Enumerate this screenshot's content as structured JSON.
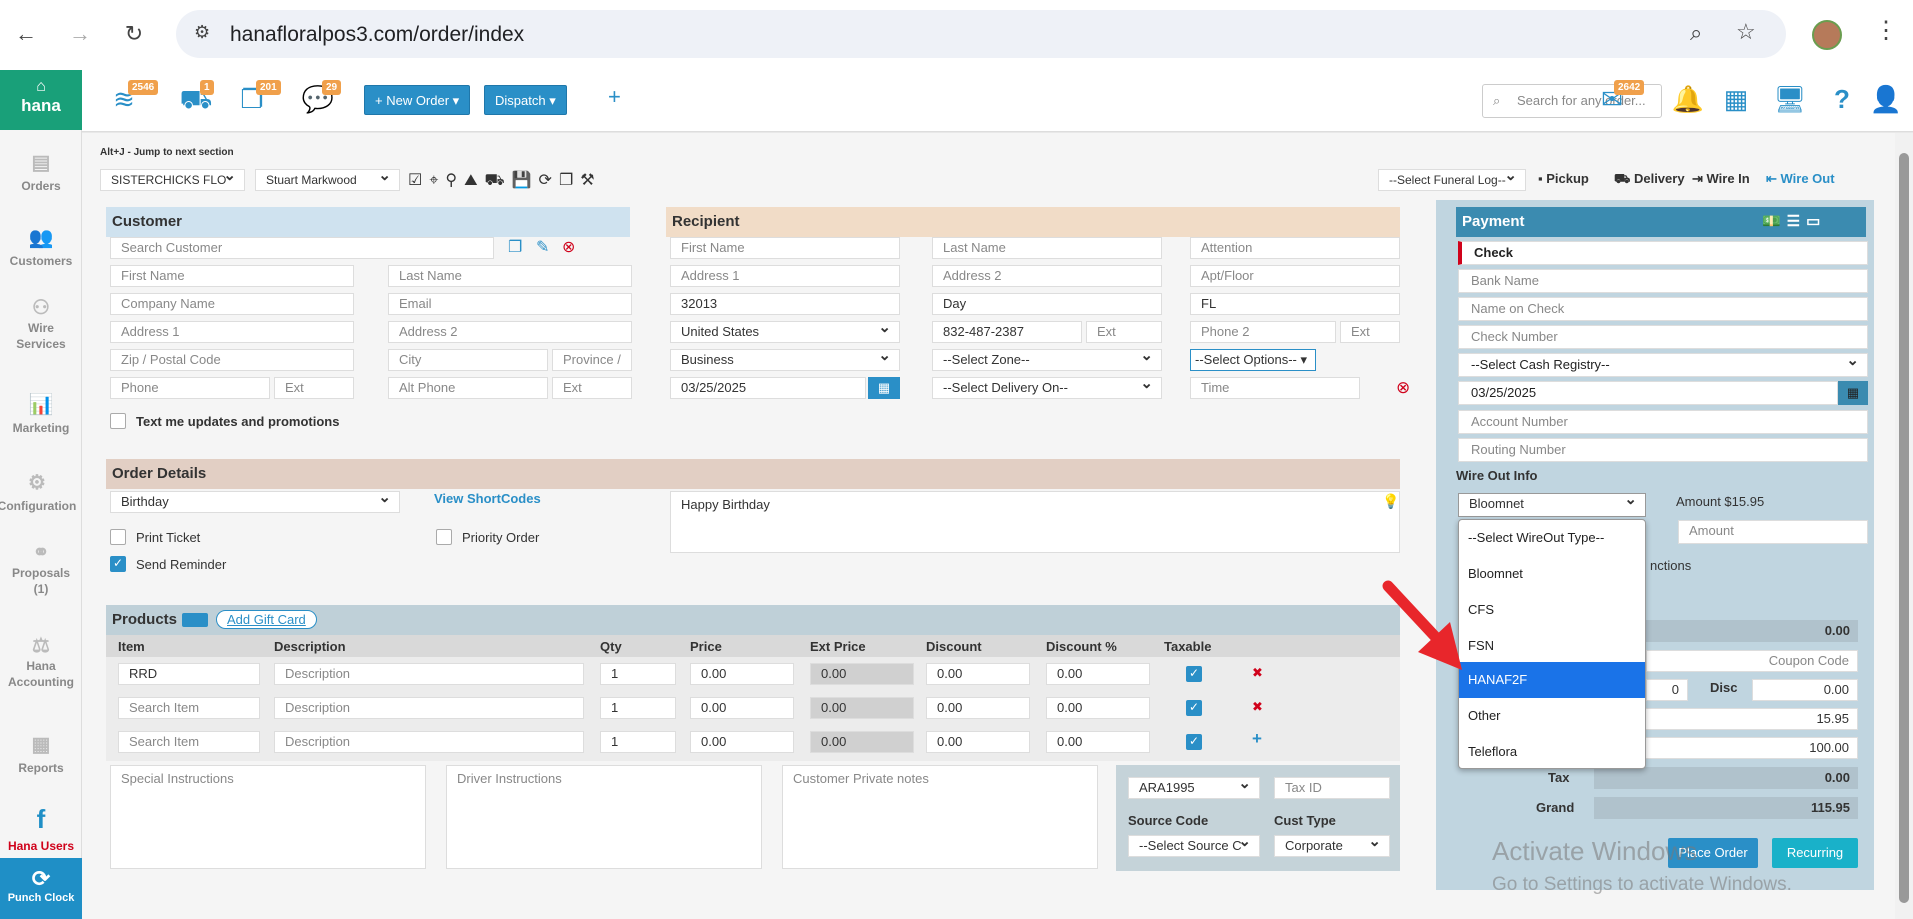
{
  "browser": {
    "url": "hanafloralpos3.com/order/index"
  },
  "sidebar": {
    "brand": "hana",
    "items": [
      {
        "label": "Orders"
      },
      {
        "label": "Customers"
      },
      {
        "label": "Wire\nServices"
      },
      {
        "label": "Marketing"
      },
      {
        "label": "Configuration"
      },
      {
        "label": "Proposals\n(1)"
      },
      {
        "label": "Hana\nAccounting"
      },
      {
        "label": "Reports"
      }
    ],
    "hana_users": "Hana Users",
    "punch_clock": "Punch Clock"
  },
  "topbar": {
    "badges": [
      "2546",
      "1",
      "201",
      "29"
    ],
    "new_order": "+ New Order ▾",
    "dispatch": "Dispatch ▾",
    "plus": "+",
    "search_placeholder": "Search for any order...",
    "mail_badge": "2642"
  },
  "toolbar": {
    "hint": "Alt+J - Jump to next section",
    "shop": "SISTERCHICKS FLO",
    "employee": "Stuart Markwood",
    "funeral": "--Select Funeral Log--",
    "pickup": "Pickup",
    "delivery": "Delivery",
    "wire_in": "Wire In",
    "wire_out": "Wire Out"
  },
  "customer": {
    "title": "Customer",
    "search": "Search Customer",
    "first": "First Name",
    "last": "Last Name",
    "company": "Company Name",
    "email": "Email",
    "addr1": "Address 1",
    "addr2": "Address 2",
    "zip": "Zip / Postal Code",
    "city": "City",
    "province": "Province /",
    "phone": "Phone",
    "ext": "Ext",
    "alt_phone": "Alt Phone",
    "ext2": "Ext",
    "text_me": "Text me updates and promotions"
  },
  "recipient": {
    "title": "Recipient",
    "first": "First Name",
    "last": "Last Name",
    "attention": "Attention",
    "addr1": "Address 1",
    "addr2": "Address 2",
    "apt": "Apt/Floor",
    "zip": "32013",
    "city": "Day",
    "state": "FL",
    "country": "United States",
    "phone": "832-487-2387",
    "ext": "Ext",
    "phone2": "Phone 2",
    "ext2": "Ext",
    "type": "Business",
    "zone": "--Select Zone--",
    "options": "--Select Options--",
    "date": "03/25/2025",
    "delivery_on": "--Select Delivery On--",
    "time": "Time"
  },
  "order": {
    "title": "Order Details",
    "occasion": "Birthday",
    "shortcodes": "View ShortCodes",
    "message": "Happy Birthday",
    "print_ticket": "Print Ticket",
    "priority": "Priority Order",
    "send_reminder": "Send Reminder"
  },
  "products": {
    "title": "Products",
    "add_gift": "Add Gift Card",
    "headers": [
      "Item",
      "Description",
      "Qty",
      "Price",
      "Ext Price",
      "Discount",
      "Discount %",
      "Taxable"
    ],
    "rows": [
      {
        "item": "RRD",
        "desc": "Description",
        "qty": "1",
        "price": "0.00",
        "ext": "0.00",
        "disc": "0.00",
        "discp": "0.00",
        "action": "✖"
      },
      {
        "item": "Search Item",
        "desc": "Description",
        "qty": "1",
        "price": "0.00",
        "ext": "0.00",
        "disc": "0.00",
        "discp": "0.00",
        "action": "✖"
      },
      {
        "item": "Search Item",
        "desc": "Description",
        "qty": "1",
        "price": "0.00",
        "ext": "0.00",
        "disc": "0.00",
        "discp": "0.00",
        "action": "+"
      }
    ]
  },
  "notes": {
    "special": "Special Instructions",
    "driver": "Driver Instructions",
    "private": "Customer Private notes",
    "ara": "ARA1995",
    "tax_id": "Tax ID",
    "source_code_label": "Source Code",
    "source_code": "--Select Source C",
    "cust_type_label": "Cust Type",
    "cust_type": "Corporate"
  },
  "payment": {
    "title": "Payment",
    "method": "Check",
    "bank": "Bank Name",
    "name_on_check": "Name on Check",
    "check_number": "Check Number",
    "cash_registry": "--Select Cash Registry--",
    "date": "03/25/2025",
    "account": "Account Number",
    "routing": "Routing Number",
    "wire_out_info": "Wire Out Info",
    "wire_type": "Bloomnet",
    "amount_label": "Amount $15.95",
    "amount_placeholder": "Amount",
    "instructions_fragment": "nctions",
    "sub_val": "0.00",
    "coupon": "Coupon Code",
    "zero": "0",
    "disc_label": "Disc",
    "disc_val": "0.00",
    "val1": "15.95",
    "val2": "100.00",
    "tax_label": "Tax",
    "tax_val": "0.00",
    "grand_label": "Grand",
    "grand_val": "115.95",
    "place_order": "Place Order",
    "recurring": "Recurring",
    "watermark1": "Activate Windows",
    "watermark2": "Go to Settings to activate Windows."
  },
  "wireout_dropdown": {
    "options": [
      "--Select WireOut Type--",
      "Bloomnet",
      "CFS",
      "FSN",
      "HANAF2F",
      "Other",
      "Teleflora"
    ],
    "selected_index": 4
  },
  "colors": {
    "brand_green": "#19a079",
    "blue": "#2a8fc7",
    "payment_blue": "#3b8bb0",
    "highlight": "#1a73e8",
    "arrow": "#e8262b"
  }
}
